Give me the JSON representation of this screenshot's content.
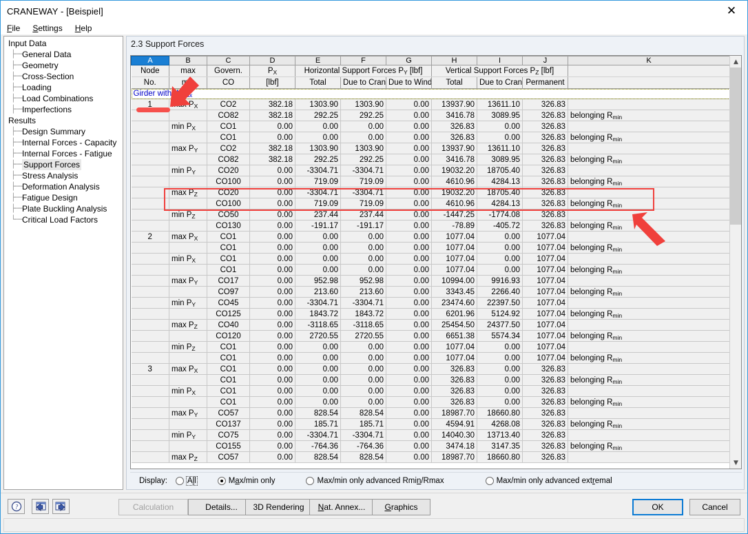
{
  "window": {
    "title": "CRANEWAY - [Beispiel]",
    "close_icon": "close-icon"
  },
  "menu": {
    "items": [
      {
        "label": "File",
        "accel": "F"
      },
      {
        "label": "Settings",
        "accel": "S"
      },
      {
        "label": "Help",
        "accel": "H"
      }
    ]
  },
  "sidebar": {
    "items": [
      {
        "label": "Input Data",
        "level": 0,
        "selected": false
      },
      {
        "label": "General Data",
        "level": 1,
        "selected": false
      },
      {
        "label": "Geometry",
        "level": 1,
        "selected": false
      },
      {
        "label": "Cross-Section",
        "level": 1,
        "selected": false
      },
      {
        "label": "Loading",
        "level": 1,
        "selected": false
      },
      {
        "label": "Load Combinations",
        "level": 1,
        "selected": false
      },
      {
        "label": "Imperfections",
        "level": 1,
        "selected": false
      },
      {
        "label": "Results",
        "level": 0,
        "selected": false
      },
      {
        "label": "Design Summary",
        "level": 1,
        "selected": false
      },
      {
        "label": "Internal Forces - Capacity",
        "level": 1,
        "selected": false
      },
      {
        "label": "Internal Forces - Fatigue",
        "level": 1,
        "selected": false
      },
      {
        "label": "Support Forces",
        "level": 1,
        "selected": true
      },
      {
        "label": "Stress Analysis",
        "level": 1,
        "selected": false
      },
      {
        "label": "Deformation Analysis",
        "level": 1,
        "selected": false
      },
      {
        "label": "Fatigue Design",
        "level": 1,
        "selected": false
      },
      {
        "label": "Plate Buckling Analysis",
        "level": 1,
        "selected": false
      },
      {
        "label": "Critical Load Factors",
        "level": 1,
        "selected": false
      }
    ]
  },
  "panel": {
    "title": "2.3 Support Forces"
  },
  "grid": {
    "column_letters": [
      "A",
      "B",
      "C",
      "D",
      "E",
      "F",
      "G",
      "H",
      "I",
      "J",
      "K"
    ],
    "selected_column": "A",
    "header_row1": {
      "a": "Node",
      "b": "max",
      "c": "Govern.",
      "d": "P",
      "d_sub": "X",
      "efg": "Horizontal Support Forces P",
      "efg_sub": "Y",
      "efg_unit": " [lbf]",
      "hij": "Vertical Support Forces P",
      "hij_sub": "Z",
      "hij_unit": " [lbf]",
      "k": ""
    },
    "header_row2": {
      "a": "No.",
      "b": "min",
      "c": "CO",
      "d": "[lbf]",
      "e": "Total",
      "f": "Due to Crane",
      "g": "Due to Wind",
      "h": "Total",
      "i": "Due to Crane",
      "j": "Permanent",
      "k": ""
    },
    "group_label": "Girder with W",
    "group_label_sub": "max",
    "rows": [
      {
        "node": "1",
        "type": "max P",
        "sub": "X",
        "co": "CO2",
        "px": "382.18",
        "px_b": true,
        "ey": "1303.90",
        "ey_b": false,
        "fy": "1303.90",
        "gy": "0.00",
        "hz": "13937.90",
        "hz_b": false,
        "iz": "13611.10",
        "jz": "326.83",
        "note": ""
      },
      {
        "node": "",
        "type": "",
        "sub": "",
        "co": "CO82",
        "px": "382.18",
        "px_b": true,
        "ey": "292.25",
        "ey_b": false,
        "fy": "292.25",
        "gy": "0.00",
        "hz": "3416.78",
        "hz_b": false,
        "iz": "3089.95",
        "jz": "326.83",
        "note": "belonging R"
      },
      {
        "node": "",
        "type": "min P",
        "sub": "X",
        "co": "CO1",
        "px": "0.00",
        "px_b": true,
        "ey": "0.00",
        "ey_b": false,
        "fy": "0.00",
        "gy": "0.00",
        "hz": "326.83",
        "hz_b": false,
        "iz": "0.00",
        "jz": "326.83",
        "note": ""
      },
      {
        "node": "",
        "type": "",
        "sub": "",
        "co": "CO1",
        "px": "0.00",
        "px_b": true,
        "ey": "0.00",
        "ey_b": false,
        "fy": "0.00",
        "gy": "0.00",
        "hz": "326.83",
        "hz_b": false,
        "iz": "0.00",
        "jz": "326.83",
        "note": "belonging R"
      },
      {
        "node": "",
        "type": "max P",
        "sub": "Y",
        "co": "CO2",
        "px": "382.18",
        "px_b": false,
        "ey": "1303.90",
        "ey_b": true,
        "fy": "1303.90",
        "gy": "0.00",
        "hz": "13937.90",
        "hz_b": false,
        "iz": "13611.10",
        "jz": "326.83",
        "note": ""
      },
      {
        "node": "",
        "type": "",
        "sub": "",
        "co": "CO82",
        "px": "382.18",
        "px_b": false,
        "ey": "292.25",
        "ey_b": true,
        "fy": "292.25",
        "gy": "0.00",
        "hz": "3416.78",
        "hz_b": false,
        "iz": "3089.95",
        "jz": "326.83",
        "note": "belonging R"
      },
      {
        "node": "",
        "type": "min P",
        "sub": "Y",
        "co": "CO20",
        "px": "0.00",
        "px_b": false,
        "ey": "-3304.71",
        "ey_b": true,
        "fy": "-3304.71",
        "gy": "0.00",
        "hz": "19032.20",
        "hz_b": false,
        "iz": "18705.40",
        "jz": "326.83",
        "note": ""
      },
      {
        "node": "",
        "type": "",
        "sub": "",
        "co": "CO100",
        "px": "0.00",
        "px_b": false,
        "ey": "719.09",
        "ey_b": true,
        "fy": "719.09",
        "gy": "0.00",
        "hz": "4610.96",
        "hz_b": false,
        "iz": "4284.13",
        "jz": "326.83",
        "note": "belonging R"
      },
      {
        "node": "",
        "type": "max P",
        "sub": "Z",
        "co": "CO20",
        "px": "0.00",
        "px_b": false,
        "ey": "-3304.71",
        "ey_b": false,
        "fy": "-3304.71",
        "gy": "0.00",
        "hz": "19032.20",
        "hz_b": true,
        "iz": "18705.40",
        "jz": "326.83",
        "note": ""
      },
      {
        "node": "",
        "type": "",
        "sub": "",
        "co": "CO100",
        "px": "0.00",
        "px_b": false,
        "ey": "719.09",
        "ey_b": false,
        "fy": "719.09",
        "gy": "0.00",
        "hz": "4610.96",
        "hz_b": true,
        "iz": "4284.13",
        "jz": "326.83",
        "note": "belonging R"
      },
      {
        "node": "",
        "type": "min P",
        "sub": "Z",
        "co": "CO50",
        "px": "0.00",
        "px_b": false,
        "ey": "237.44",
        "ey_b": false,
        "fy": "237.44",
        "gy": "0.00",
        "hz": "-1447.25",
        "hz_b": true,
        "iz": "-1774.08",
        "jz": "326.83",
        "note": ""
      },
      {
        "node": "",
        "type": "",
        "sub": "",
        "co": "CO130",
        "px": "0.00",
        "px_b": false,
        "ey": "-191.17",
        "ey_b": false,
        "fy": "-191.17",
        "gy": "0.00",
        "hz": "-78.89",
        "hz_b": true,
        "iz": "-405.72",
        "jz": "326.83",
        "note": "belonging R"
      },
      {
        "node": "2",
        "type": "max P",
        "sub": "X",
        "co": "CO1",
        "px": "0.00",
        "px_b": true,
        "ey": "0.00",
        "ey_b": false,
        "fy": "0.00",
        "gy": "0.00",
        "hz": "1077.04",
        "hz_b": false,
        "iz": "0.00",
        "jz": "1077.04",
        "note": ""
      },
      {
        "node": "",
        "type": "",
        "sub": "",
        "co": "CO1",
        "px": "0.00",
        "px_b": true,
        "ey": "0.00",
        "ey_b": false,
        "fy": "0.00",
        "gy": "0.00",
        "hz": "1077.04",
        "hz_b": false,
        "iz": "0.00",
        "jz": "1077.04",
        "note": "belonging R"
      },
      {
        "node": "",
        "type": "min P",
        "sub": "X",
        "co": "CO1",
        "px": "0.00",
        "px_b": true,
        "ey": "0.00",
        "ey_b": false,
        "fy": "0.00",
        "gy": "0.00",
        "hz": "1077.04",
        "hz_b": false,
        "iz": "0.00",
        "jz": "1077.04",
        "note": ""
      },
      {
        "node": "",
        "type": "",
        "sub": "",
        "co": "CO1",
        "px": "0.00",
        "px_b": true,
        "ey": "0.00",
        "ey_b": false,
        "fy": "0.00",
        "gy": "0.00",
        "hz": "1077.04",
        "hz_b": false,
        "iz": "0.00",
        "jz": "1077.04",
        "note": "belonging R"
      },
      {
        "node": "",
        "type": "max P",
        "sub": "Y",
        "co": "CO17",
        "px": "0.00",
        "px_b": false,
        "ey": "952.98",
        "ey_b": true,
        "fy": "952.98",
        "gy": "0.00",
        "hz": "10994.00",
        "hz_b": false,
        "iz": "9916.93",
        "jz": "1077.04",
        "note": ""
      },
      {
        "node": "",
        "type": "",
        "sub": "",
        "co": "CO97",
        "px": "0.00",
        "px_b": false,
        "ey": "213.60",
        "ey_b": true,
        "fy": "213.60",
        "gy": "0.00",
        "hz": "3343.45",
        "hz_b": false,
        "iz": "2266.40",
        "jz": "1077.04",
        "note": "belonging R"
      },
      {
        "node": "",
        "type": "min P",
        "sub": "Y",
        "co": "CO45",
        "px": "0.00",
        "px_b": false,
        "ey": "-3304.71",
        "ey_b": true,
        "fy": "-3304.71",
        "gy": "0.00",
        "hz": "23474.60",
        "hz_b": false,
        "iz": "22397.50",
        "jz": "1077.04",
        "note": ""
      },
      {
        "node": "",
        "type": "",
        "sub": "",
        "co": "CO125",
        "px": "0.00",
        "px_b": false,
        "ey": "1843.72",
        "ey_b": true,
        "fy": "1843.72",
        "gy": "0.00",
        "hz": "6201.96",
        "hz_b": false,
        "iz": "5124.92",
        "jz": "1077.04",
        "note": "belonging R"
      },
      {
        "node": "",
        "type": "max P",
        "sub": "Z",
        "co": "CO40",
        "px": "0.00",
        "px_b": false,
        "ey": "-3118.65",
        "ey_b": false,
        "fy": "-3118.65",
        "gy": "0.00",
        "hz": "25454.50",
        "hz_b": true,
        "iz": "24377.50",
        "jz": "1077.04",
        "note": ""
      },
      {
        "node": "",
        "type": "",
        "sub": "",
        "co": "CO120",
        "px": "0.00",
        "px_b": false,
        "ey": "2720.55",
        "ey_b": false,
        "fy": "2720.55",
        "gy": "0.00",
        "hz": "6651.38",
        "hz_b": true,
        "iz": "5574.34",
        "jz": "1077.04",
        "note": "belonging R"
      },
      {
        "node": "",
        "type": "min P",
        "sub": "Z",
        "co": "CO1",
        "px": "0.00",
        "px_b": false,
        "ey": "0.00",
        "ey_b": false,
        "fy": "0.00",
        "gy": "0.00",
        "hz": "1077.04",
        "hz_b": true,
        "iz": "0.00",
        "jz": "1077.04",
        "note": ""
      },
      {
        "node": "",
        "type": "",
        "sub": "",
        "co": "CO1",
        "px": "0.00",
        "px_b": false,
        "ey": "0.00",
        "ey_b": false,
        "fy": "0.00",
        "gy": "0.00",
        "hz": "1077.04",
        "hz_b": true,
        "iz": "0.00",
        "jz": "1077.04",
        "note": "belonging R"
      },
      {
        "node": "3",
        "type": "max P",
        "sub": "X",
        "co": "CO1",
        "px": "0.00",
        "px_b": true,
        "ey": "0.00",
        "ey_b": false,
        "fy": "0.00",
        "gy": "0.00",
        "hz": "326.83",
        "hz_b": false,
        "iz": "0.00",
        "jz": "326.83",
        "note": ""
      },
      {
        "node": "",
        "type": "",
        "sub": "",
        "co": "CO1",
        "px": "0.00",
        "px_b": true,
        "ey": "0.00",
        "ey_b": false,
        "fy": "0.00",
        "gy": "0.00",
        "hz": "326.83",
        "hz_b": false,
        "iz": "0.00",
        "jz": "326.83",
        "note": "belonging R"
      },
      {
        "node": "",
        "type": "min P",
        "sub": "X",
        "co": "CO1",
        "px": "0.00",
        "px_b": true,
        "ey": "0.00",
        "ey_b": false,
        "fy": "0.00",
        "gy": "0.00",
        "hz": "326.83",
        "hz_b": false,
        "iz": "0.00",
        "jz": "326.83",
        "note": ""
      },
      {
        "node": "",
        "type": "",
        "sub": "",
        "co": "CO1",
        "px": "0.00",
        "px_b": true,
        "ey": "0.00",
        "ey_b": false,
        "fy": "0.00",
        "gy": "0.00",
        "hz": "326.83",
        "hz_b": false,
        "iz": "0.00",
        "jz": "326.83",
        "note": "belonging R"
      },
      {
        "node": "",
        "type": "max P",
        "sub": "Y",
        "co": "CO57",
        "px": "0.00",
        "px_b": false,
        "ey": "828.54",
        "ey_b": true,
        "fy": "828.54",
        "gy": "0.00",
        "hz": "18987.70",
        "hz_b": false,
        "iz": "18660.80",
        "jz": "326.83",
        "note": ""
      },
      {
        "node": "",
        "type": "",
        "sub": "",
        "co": "CO137",
        "px": "0.00",
        "px_b": false,
        "ey": "185.71",
        "ey_b": true,
        "fy": "185.71",
        "gy": "0.00",
        "hz": "4594.91",
        "hz_b": false,
        "iz": "4268.08",
        "jz": "326.83",
        "note": "belonging R"
      },
      {
        "node": "",
        "type": "min P",
        "sub": "Y",
        "co": "CO75",
        "px": "0.00",
        "px_b": false,
        "ey": "-3304.71",
        "ey_b": true,
        "fy": "-3304.71",
        "gy": "0.00",
        "hz": "14040.30",
        "hz_b": false,
        "iz": "13713.40",
        "jz": "326.83",
        "note": ""
      },
      {
        "node": "",
        "type": "",
        "sub": "",
        "co": "CO155",
        "px": "0.00",
        "px_b": false,
        "ey": "-764.36",
        "ey_b": true,
        "fy": "-764.36",
        "gy": "0.00",
        "hz": "3474.18",
        "hz_b": false,
        "iz": "3147.35",
        "jz": "326.83",
        "note": "belonging R"
      },
      {
        "node": "",
        "type": "max P",
        "sub": "Z",
        "co": "CO57",
        "px": "0.00",
        "px_b": false,
        "ey": "828.54",
        "ey_b": false,
        "fy": "828.54",
        "gy": "0.00",
        "hz": "18987.70",
        "hz_b": true,
        "iz": "18660.80",
        "jz": "326.83",
        "note": ""
      }
    ],
    "note_sub": "min"
  },
  "display": {
    "label": "Display:",
    "options": [
      {
        "label": "All",
        "accel_index": 1,
        "selected": false,
        "focused": true
      },
      {
        "label": "Max/min only",
        "accel_index": 1,
        "selected": true,
        "focused": false
      },
      {
        "label": "Max/min only advanced Rmin/Rmax",
        "accel_index": 25,
        "selected": false,
        "focused": false
      },
      {
        "label": "Max/min only advanced extremal",
        "accel_index": 25,
        "selected": false,
        "focused": false
      }
    ]
  },
  "toolbar": {
    "help_icon": "help-icon",
    "prev_icon": "previous-arrow-icon",
    "next_icon": "next-arrow-icon"
  },
  "buttons": {
    "calculation": "Calculation",
    "details": "Details...",
    "rendering": "3D Rendering",
    "annex": "Nat. Annex...",
    "graphics": "Graphics",
    "ok": "OK",
    "cancel": "Cancel"
  },
  "annotations": {
    "accent_color": "#f0403c",
    "box_label": "highlight-box-max-pz",
    "arrow1_label": "arrow-pointing-to-govern-co",
    "arrow2_label": "arrow-pointing-to-highlight-box",
    "bar_label": "underline-node-1"
  }
}
